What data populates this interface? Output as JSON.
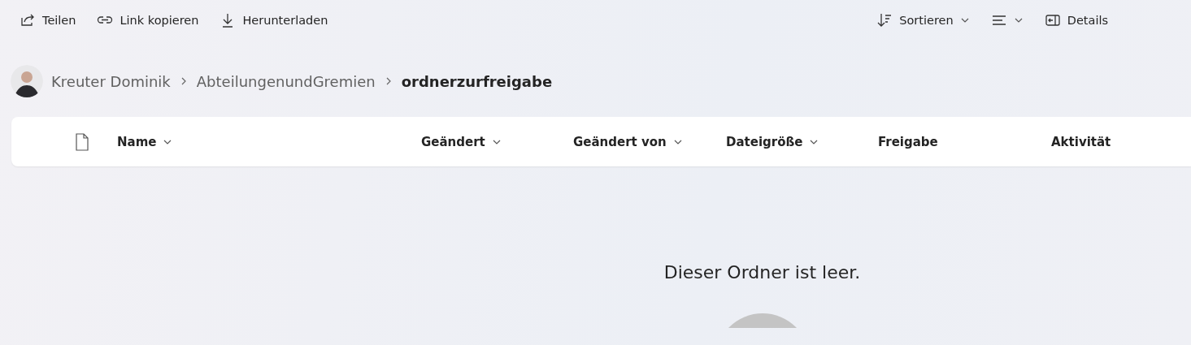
{
  "toolbar": {
    "left": [
      {
        "label": "Teilen",
        "dropdown": false
      },
      {
        "label": "Link kopieren",
        "dropdown": false
      },
      {
        "label": "Herunterladen",
        "dropdown": false
      }
    ],
    "right": [
      {
        "label": "Sortieren",
        "dropdown": true
      },
      {
        "dropdown": true
      },
      {
        "label": "Details",
        "dropdown": false
      }
    ]
  },
  "breadcrumb": [
    {
      "label": "Kreuter Dominik",
      "current": false
    },
    {
      "label": "AbteilungenundGremien",
      "current": false
    },
    {
      "label": "ordnerzurfreigabe",
      "current": true
    }
  ],
  "table": {
    "columns": [
      {
        "label": "Name",
        "sortable": true
      },
      {
        "label": "Geändert",
        "sortable": true
      },
      {
        "label": "Geändert von",
        "sortable": true
      },
      {
        "label": "Dateigröße",
        "sortable": true
      },
      {
        "label": "Freigabe",
        "sortable": false
      },
      {
        "label": "Aktivität",
        "sortable": false
      }
    ]
  },
  "empty_state": {
    "message": "Dieser Ordner ist leer."
  }
}
